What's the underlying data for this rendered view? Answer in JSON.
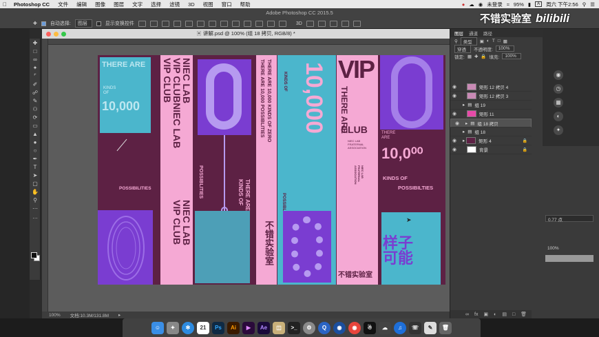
{
  "menubar": {
    "app": "Photoshop CC",
    "items": [
      "文件",
      "编辑",
      "图像",
      "图层",
      "文字",
      "选择",
      "滤镜",
      "3D",
      "视图",
      "窗口",
      "帮助"
    ],
    "status": {
      "user": "未登录",
      "battery": "95%",
      "datetime": "周六 下午2:56"
    }
  },
  "app_title": "Adobe Photoshop CC 2015.5",
  "optionsbar": {
    "auto_select_label": "自动选择:",
    "auto_select_value": "图层",
    "show_transform_label": "显示变换控件"
  },
  "document": {
    "title": "讲解.psd @ 100% (组 18 拷贝, RGB/8) *",
    "zoom": "100%",
    "doc_size": "文档:10.3M/131.8M"
  },
  "artboard": {
    "colors": {
      "bg": "#5d2144",
      "cyan": "#4bb6cc",
      "pink": "#f5a9d4",
      "purple": "#7a3dd1",
      "dark_purple": "#3d1352"
    },
    "texts": {
      "s1_there_are": "THERE ARE",
      "s1_kinds_of": "KINDS\nOF",
      "s1_number": "10,000",
      "s1_possibilities": "POSSIBILITIES",
      "s2_vertical": "NIEC LAB\nVIP CLUBNIEC LAB\nVIP CLUB",
      "s2_vertical_b": "NIEC LAB\nVIP CLUB",
      "s3_possiblities": "POSSIBLITIES",
      "s4_line1": "THERE ARE 10,000 KINDS OF ZERO",
      "s4_line2": "THERE ARE 10,000 POSSIBLITIES",
      "s4_there_are": "THERE ARE",
      "s4_kinds_of": "KINDS OF",
      "s4_logo": "不错实验室",
      "s5_kinds_of": "KINDS OF",
      "s5_number": "10,000",
      "s5_possiblities": "POSSIBLITIES",
      "s6_there_are": "THERE ARE",
      "s6_vip": "VIP",
      "s6_club": "CLUB",
      "s6_niec_lab": "NIEC LAB\nFRATERNAL\nASSOCIATION",
      "s6_logo": "不错实验室",
      "s7_there_are": "THERE\nARE",
      "s7_number": "10,0⁰⁰",
      "s7_kinds_of": "KINDS OF",
      "s7_possibilties": "POSSIBILTIES",
      "s7_chinese": "样子\n可能"
    }
  },
  "layers_panel": {
    "tabs": [
      "图层",
      "通道",
      "路径"
    ],
    "kind_label": "类型",
    "blend_mode": "穿透",
    "opacity_label": "不透明度:",
    "opacity_value": "100%",
    "fill_label": "填充:",
    "fill_value": "100%",
    "lock_label": "锁定:",
    "layers": [
      {
        "name": "矩形 12 拷贝 4",
        "thumb": "#c98ab5"
      },
      {
        "name": "矩形 12 拷贝 3",
        "thumb": "#c98ab5"
      },
      {
        "name": "组 19",
        "thumb": "#555555"
      },
      {
        "name": "矩形 11",
        "thumb": "#e64aa8"
      },
      {
        "name": "组 18 拷贝",
        "thumb": "#555555"
      },
      {
        "name": "组 18",
        "thumb": "#555555"
      },
      {
        "name": "矩形 4",
        "thumb": "#5d2144"
      },
      {
        "name": "背景",
        "thumb": "#ffffff"
      }
    ]
  },
  "properties_panel": {
    "stroke_value": "0.77 点",
    "percent": "100%",
    "mode": "矩形"
  },
  "watermark": {
    "text": "不错实验室",
    "bili": "bilibili"
  },
  "dock": {
    "apps": [
      "finder-icon",
      "launchpad-icon",
      "safari-icon",
      "calendar-icon",
      "photoshop-icon",
      "illustrator-icon",
      "premiere-icon",
      "aftereffects-icon",
      "preview-icon",
      "terminal-icon",
      "settings-icon",
      "quicktime-icon",
      "screenshot-icon",
      "chrome-icon",
      "qq-icon",
      "wechat-icon",
      "music-icon",
      "phone-icon",
      "notes-icon",
      "trash-icon"
    ],
    "calendar_day": "21",
    "ps_label": "Ps",
    "ai_label": "Ai",
    "ae_label": "Ae"
  }
}
